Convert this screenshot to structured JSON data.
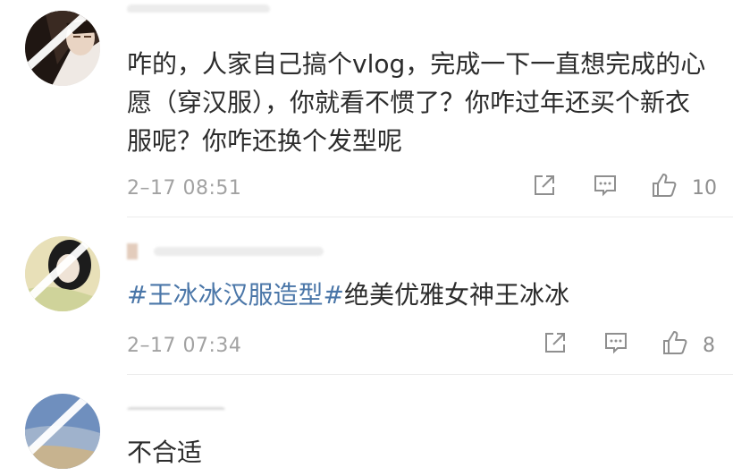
{
  "comments": [
    {
      "username": "",
      "text": "咋的，人家自己搞个vlog，完成一下一直想完成的心愿（穿汉服），你就看不惯了？你咋过年还买个新衣服呢？你咋还换个发型呢",
      "timestamp": "2–17 08:51",
      "likes": "10",
      "avatar_color": "#3a2a22"
    },
    {
      "username": "",
      "hashtag1": "#王冰冰汉服造型#",
      "text_rest": "绝美优雅女神王冰冰",
      "timestamp": "2–17 07:34",
      "likes": "8",
      "avatar_color": "#d6cda0"
    },
    {
      "username": "",
      "text": "不合适",
      "avatar_color": "#7f96b8"
    }
  ],
  "icons": {
    "share": "share-icon",
    "comment": "comment-icon",
    "like": "thumbs-up-icon"
  },
  "colors": {
    "hashtag": "#4a76a8",
    "text": "#2c2c2c",
    "meta": "#a2a2a2",
    "icon": "#8f8f8f"
  }
}
